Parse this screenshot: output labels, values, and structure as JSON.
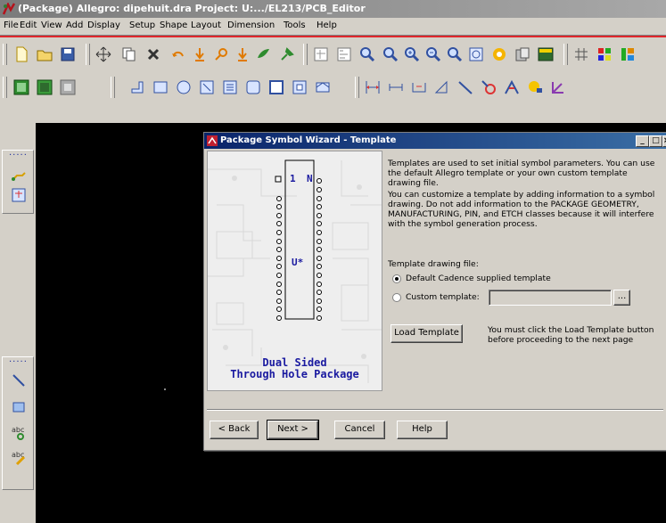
{
  "window": {
    "title": "(Package) Allegro: dipehuit.dra  Project: U:.../EL213/PCB_Editor"
  },
  "menu": {
    "items": [
      "File",
      "Edit",
      "View",
      "Add",
      "Display",
      "Setup",
      "Shape",
      "Layout",
      "Dimension",
      "Tools",
      "Help"
    ]
  },
  "toolbar1": {
    "icons": [
      "new-file-icon",
      "open-folder-icon",
      "save-icon",
      "move-icon",
      "copy-icon",
      "delete-icon",
      "undo-icon",
      "redo-icon",
      "pin-icon",
      "unrats-icon",
      "zoom-fit-icon",
      "zoom-in-icon",
      "zoom-out-icon",
      "zoom-previous-icon",
      "refresh-icon",
      "shaded-3d-icon",
      "flip-icon",
      "grid-icon",
      "color-icon"
    ]
  },
  "toolbar2": {
    "icons": [
      "layer-visibility-icon",
      "layer-all-icon",
      "layer-none-icon",
      "add-pin-icon",
      "rectangle-icon",
      "circle-icon",
      "text-icon",
      "line-icon",
      "rounded-rect-icon",
      "square-icon",
      "frame-icon",
      "dimension-linear-icon",
      "dimension-datum-icon",
      "dimension-angle-icon",
      "leader-icon",
      "balloon-icon",
      "chamfer-icon",
      "fillet-icon",
      "measure-icon"
    ]
  },
  "dialog": {
    "title": "Package Symbol Wizard - Template",
    "intro": "Templates are used to set initial symbol parameters. You can use the default Allegro template or your own custom template drawing file.",
    "customize": "You can customize a template by adding information to a symbol drawing. Do not add information to the PACKAGE GEOMETRY, MANUFACTURING, PIN, and ETCH classes because it will interfere with the symbol generation process.",
    "template_label": "Template drawing file:",
    "option_default": "Default Cadence supplied template",
    "option_custom": "Custom template:",
    "custom_value": "",
    "browse_label": "...",
    "load_button": "Load Template",
    "load_note": "You must click the Load Template button before proceeding to the next page",
    "preview": {
      "pin1": "1",
      "pinN": "N",
      "refdes": "U*",
      "caption_line1": "Dual Sided",
      "caption_line2": "Through Hole Package"
    },
    "buttons": {
      "back": "< Back",
      "next": "Next >",
      "cancel": "Cancel",
      "help": "Help"
    },
    "selected_option": "default"
  }
}
